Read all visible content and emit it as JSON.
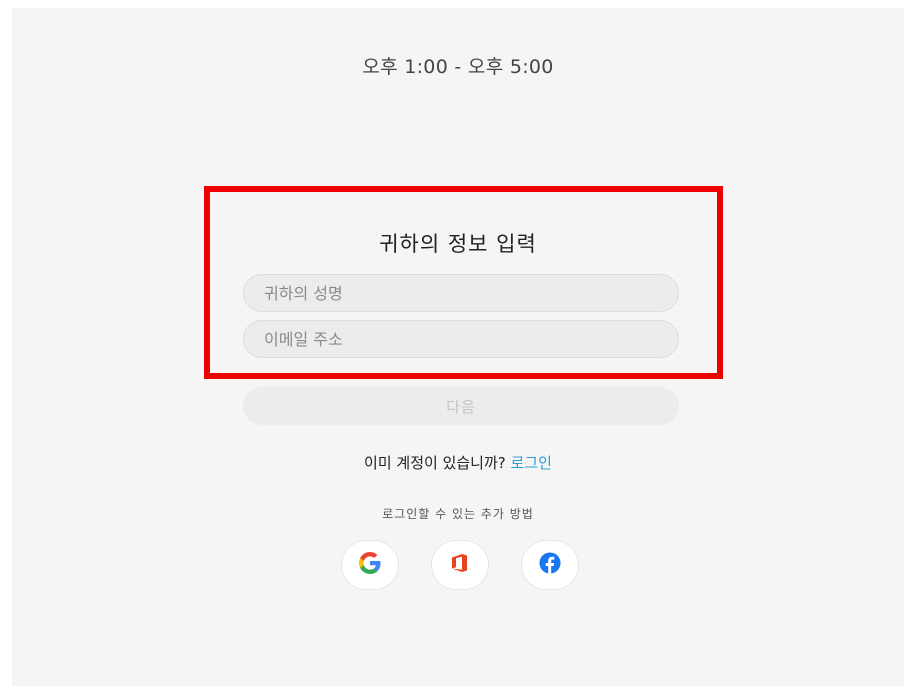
{
  "schedule": {
    "time_range": "오후 1:00 - 오후 5:00"
  },
  "form": {
    "title": "귀하의 정보 입력",
    "name_placeholder": "귀하의 성명",
    "email_placeholder": "이메일 주소",
    "next_label": "다음"
  },
  "account": {
    "prompt": "이미 계정이 있습니까?",
    "login_link": "로그인"
  },
  "alt_login": {
    "label": "로그인할 수 있는 추가 방법",
    "providers": [
      "google-icon",
      "office-icon",
      "facebook-icon"
    ]
  },
  "colors": {
    "highlight": "#ee0000",
    "link": "#2b9ed8",
    "office": "#e8441b",
    "facebook": "#1877f2"
  }
}
